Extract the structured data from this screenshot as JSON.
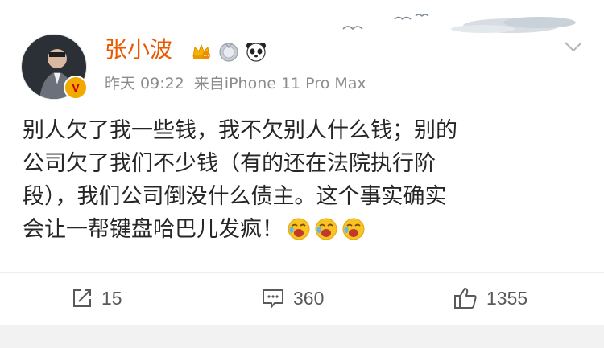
{
  "post": {
    "author": {
      "name": "张小波",
      "verified_badge": "V",
      "badges": [
        "crown-badge-icon",
        "medal-badge-icon",
        "panda-icon"
      ]
    },
    "meta": {
      "time": "昨天 09:22",
      "source": "来自iPhone 11 Pro Max"
    },
    "content_lines": [
      "别人欠了我一些钱，我不欠别人什么钱；别的",
      "公司欠了我们不少钱（有的还在法院执行阶",
      "段），我们公司倒没什么债主。这个事实确实",
      "会让一帮键盘哈巴儿发疯！"
    ],
    "emojis": [
      "laughing-cry-emoji",
      "laughing-cry-emoji",
      "laughing-cry-emoji"
    ],
    "actions": {
      "repost_count": "15",
      "comment_count": "360",
      "like_count": "1355"
    }
  },
  "colors": {
    "username": "#ea5a00",
    "meta": "#8c8c8c",
    "text": "#262626",
    "action": "#595959",
    "verified": "#f2a900"
  }
}
